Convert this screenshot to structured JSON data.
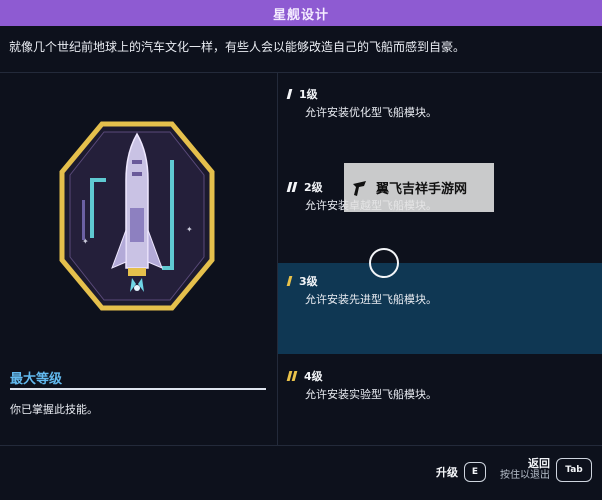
{
  "header": {
    "title": "星舰设计"
  },
  "description": "就像几个世纪前地球上的汽车文化一样，有些人会以能够改造自己的飞船而感到自豪。",
  "max_level": {
    "title": "最大等级",
    "text": "你已掌握此技能。"
  },
  "levels": [
    {
      "name": "1级",
      "desc": "允许安装优化型飞船模块。",
      "pips": 1,
      "active": false
    },
    {
      "name": "2级",
      "desc": "允许安装卓越型飞船模块。",
      "pips": 2,
      "active": false
    },
    {
      "name": "3级",
      "desc": "允许安装先进型飞船模块。",
      "pips": 1,
      "active": true
    },
    {
      "name": "4级",
      "desc": "允许安装实验型飞船模块。",
      "pips": 2,
      "active": false
    }
  ],
  "watermark": {
    "text": "翼飞吉祥手游网"
  },
  "footer": {
    "upgrade_label": "升级",
    "upgrade_key": "E",
    "back_label": "返回",
    "hold_label": "按住以退出",
    "back_key": "Tab"
  },
  "colors": {
    "title_bar": "#8e5bd2",
    "accent_blue": "#62b9ee",
    "active_row": "#0f3753",
    "gold": "#e9c24a"
  },
  "icons": [
    "rocket-badge-icon",
    "level-pips-icon",
    "watermark-logo-icon",
    "cursor-ring"
  ]
}
